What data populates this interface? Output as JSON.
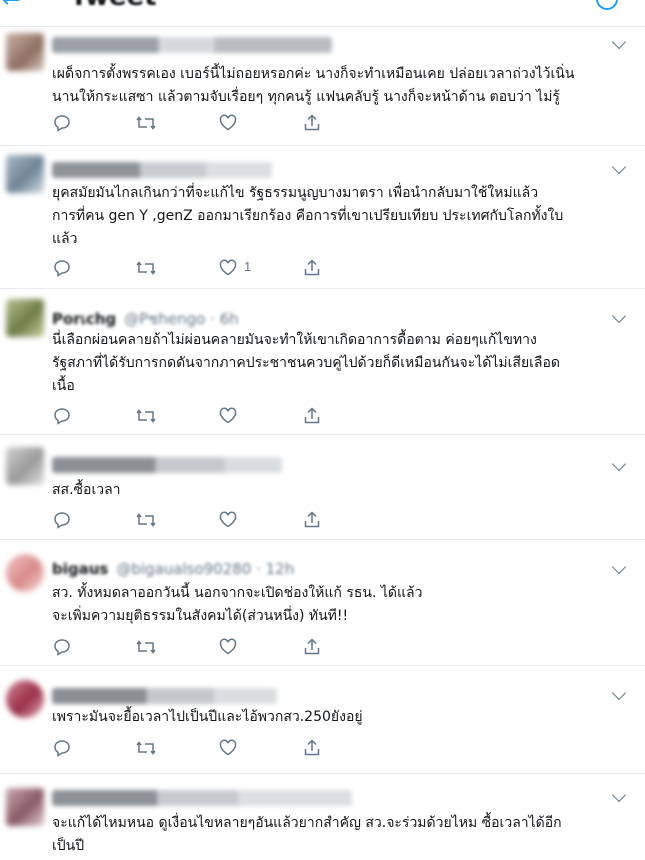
{
  "header": {
    "title": "Tweet",
    "back_icon": "back-arrow-icon",
    "info_icon": "info-icon"
  },
  "colors": {
    "accent": "#1da1f2",
    "text": "#14171a",
    "muted": "#657786",
    "divider": "#e6ecf0"
  },
  "action_icons": [
    "reply-icon",
    "retweet-icon",
    "like-icon",
    "share-icon"
  ],
  "tweets": [
    {
      "name": "",
      "handle": "",
      "text": "เผด็จการตั้งพรรคเอง เบอร์นี้ไม่ถอยหรอกค่ะ นางก็จะทำเหมือนเคย ปล่อยเวลาถ่วงไว้เนิ่น\nนานให้กระแสซา แล้วตามจับเรื่อยๆ ทุกคนรู้ แฟนคลับรู้ นางก็จะหน้าด้าน ตอบว่า ไม่รู้",
      "likes": ""
    },
    {
      "name": "",
      "handle": "",
      "text": "ยุคสมัยมันไกลเกินกว่าที่จะแก้ไข รัฐธรรมนูญบางมาตรา เพื่อนำกลับมาใช้ใหม่แล้ว\nการที่คน gen Y ,genZ ออกมาเรียกร้อง คือการที่เขาเปรียบเทียบ ประเทศกับโลกทั้งใบ\nแล้ว",
      "likes": "1"
    },
    {
      "name": "Porเchg",
      "handle": "@Pชhengo · 6h",
      "text": "นี่เลือกผ่อนคลายถ้าไม่ผ่อนคลายมันจะทำให้เขาเกิดอาการดื้อตาม ค่อยๆแก้ไขทาง\nรัฐสภาที่ได้รับการกดดันจากภาคประชาชนควบคู่ไปด้วยก็ดีเหมือนกันจะได้ไม่เสียเลือด\nเนื้อ",
      "likes": ""
    },
    {
      "name": "",
      "handle": "",
      "text": "สส.ซื้อเวลา",
      "likes": ""
    },
    {
      "name": "bigaus",
      "handle": "@bigaualso90280 · 12h",
      "text": "สว. ทั้งหมดลาออกวันนี้ นอกจากจะเปิดช่องให้แก้ รธน. ได้แล้ว\nจะเพิ่มความยุติธรรมในสังคมได้(ส่วนหนึ่ง) ทันที!!",
      "likes": ""
    },
    {
      "name": "",
      "handle": "",
      "text": "เพราะมันจะยื้อเวลาไปเป็นปีและไอ้พวกสว.250ยังอยู่",
      "likes": ""
    },
    {
      "name": "",
      "handle": "",
      "text": "จะแก้ได้ไหมหนอ ดูเงื่อนไขหลายๆอันแล้วยากสำคัญ สว.จะร่วมด้วยไหม ซื้อเวลาได้อีก\nเป็นปี",
      "likes": ""
    }
  ]
}
